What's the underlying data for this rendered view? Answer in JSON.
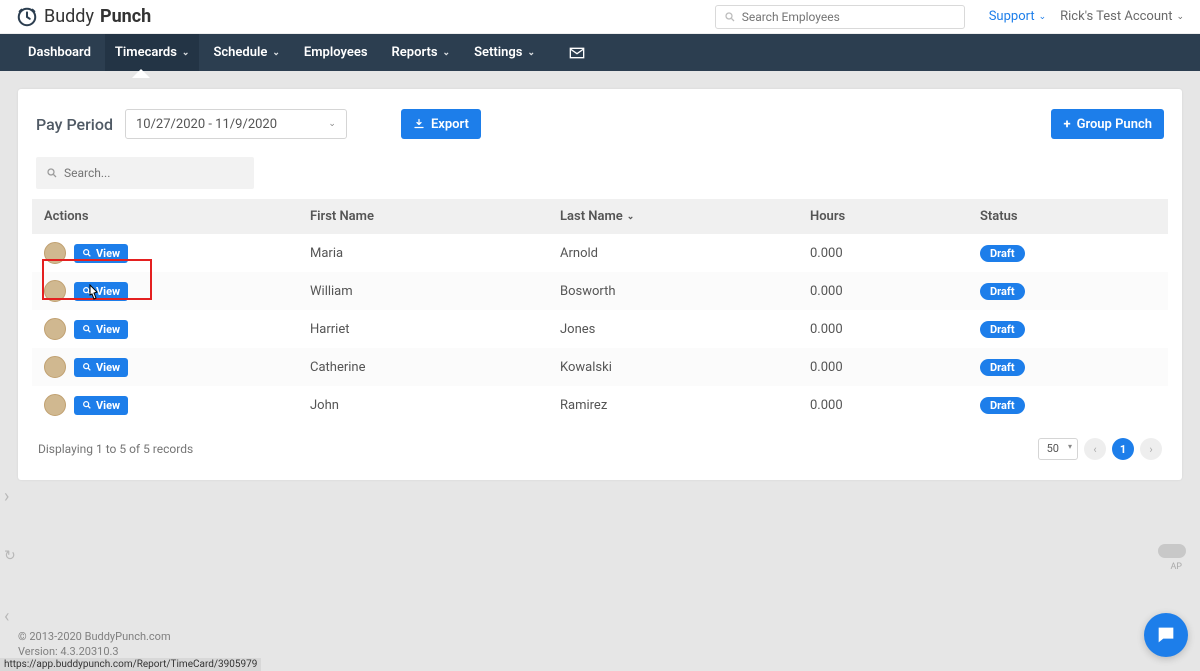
{
  "brand": {
    "name1": "Buddy",
    "name2": "Punch"
  },
  "header": {
    "search_placeholder": "Search Employees",
    "support": "Support",
    "account": "Rick's Test Account"
  },
  "nav": {
    "dashboard": "Dashboard",
    "timecards": "Timecards",
    "schedule": "Schedule",
    "employees": "Employees",
    "reports": "Reports",
    "settings": "Settings"
  },
  "toolbar": {
    "pay_label": "Pay Period",
    "date_range": "10/27/2020 - 11/9/2020",
    "export": "Export",
    "group_punch": "Group Punch"
  },
  "search": {
    "placeholder": "Search..."
  },
  "columns": {
    "actions": "Actions",
    "first": "First Name",
    "last": "Last Name",
    "hours": "Hours",
    "status": "Status"
  },
  "view_label": "View",
  "status_draft": "Draft",
  "rows": [
    {
      "first": "Maria",
      "last": "Arnold",
      "hours": "0.000",
      "status": "Draft"
    },
    {
      "first": "William",
      "last": "Bosworth",
      "hours": "0.000",
      "status": "Draft"
    },
    {
      "first": "Harriet",
      "last": "Jones",
      "hours": "0.000",
      "status": "Draft"
    },
    {
      "first": "Catherine",
      "last": "Kowalski",
      "hours": "0.000",
      "status": "Draft"
    },
    {
      "first": "John",
      "last": "Ramirez",
      "hours": "0.000",
      "status": "Draft"
    }
  ],
  "footer": {
    "records": "Displaying 1 to 5 of 5 records",
    "perpage": "50",
    "page": "1"
  },
  "page_footer": {
    "copyright": "© 2013-2020 BuddyPunch.com",
    "version": "Version: 4.3.20310.3"
  },
  "statusbar": "https://app.buddypunch.com/Report/TimeCard/3905979",
  "small_ap": "AP"
}
